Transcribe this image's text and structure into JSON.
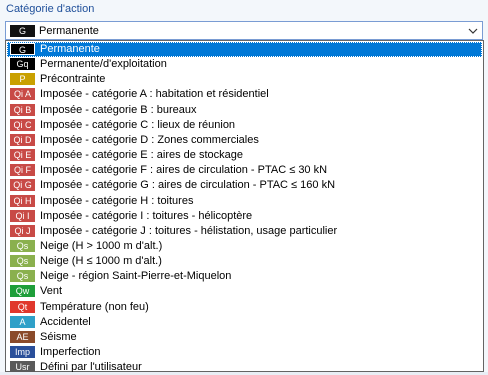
{
  "section": {
    "label": "Catégorie d'action"
  },
  "combo": {
    "badge": "G",
    "badge_color": "#111111",
    "value": "Permanente",
    "icon": "chevron-down-icon"
  },
  "items": [
    {
      "badge": "G",
      "color": "#000000",
      "label": "Permanente",
      "selected": true
    },
    {
      "badge": "Gq",
      "color": "#000000",
      "label": "Permanente/d'exploitation"
    },
    {
      "badge": "P",
      "color": "#c9a000",
      "label": "Précontrainte"
    },
    {
      "badge": "Qi A",
      "color": "#c84a46",
      "label": "Imposée - catégorie A : habitation et résidentiel"
    },
    {
      "badge": "Qi B",
      "color": "#c84a46",
      "label": "Imposée - catégorie B : bureaux"
    },
    {
      "badge": "Qi C",
      "color": "#c84a46",
      "label": "Imposée - catégorie C : lieux de réunion"
    },
    {
      "badge": "Qi D",
      "color": "#c84a46",
      "label": "Imposée - catégorie D : Zones commerciales"
    },
    {
      "badge": "Qi E",
      "color": "#c84a46",
      "label": "Imposée - catégorie E : aires de stockage"
    },
    {
      "badge": "Qi F",
      "color": "#c84a46",
      "label": "Imposée - catégorie F : aires de circulation - PTAC ≤ 30 kN"
    },
    {
      "badge": "Qi G",
      "color": "#c84a46",
      "label": "Imposée - catégorie G : aires de circulation - PTAC ≤ 160 kN"
    },
    {
      "badge": "Qi H",
      "color": "#c84a46",
      "label": "Imposée - catégorie H : toitures"
    },
    {
      "badge": "Qi I",
      "color": "#c84a46",
      "label": "Imposée - catégorie I : toitures - hélicoptère"
    },
    {
      "badge": "Qi J",
      "color": "#c84a46",
      "label": "Imposée - catégorie J : toitures - hélistation, usage particulier"
    },
    {
      "badge": "Qs",
      "color": "#8ab04e",
      "label": "Neige (H > 1000 m d'alt.)"
    },
    {
      "badge": "Qs",
      "color": "#8ab04e",
      "label": "Neige (H ≤ 1000 m d'alt.)"
    },
    {
      "badge": "Qs",
      "color": "#8ab04e",
      "label": "Neige - région Saint-Pierre-et-Miquelon"
    },
    {
      "badge": "Qw",
      "color": "#1e9e3a",
      "label": "Vent"
    },
    {
      "badge": "Qt",
      "color": "#e0372c",
      "label": "Température (non feu)"
    },
    {
      "badge": "A",
      "color": "#2fa0c8",
      "label": "Accidentel"
    },
    {
      "badge": "AE",
      "color": "#8a4a2a",
      "label": "Séisme"
    },
    {
      "badge": "Imp",
      "color": "#2a4f9a",
      "label": "Imperfection"
    },
    {
      "badge": "Usr",
      "color": "#5a5a5a",
      "label": "Défini par l'utilisateur"
    }
  ]
}
